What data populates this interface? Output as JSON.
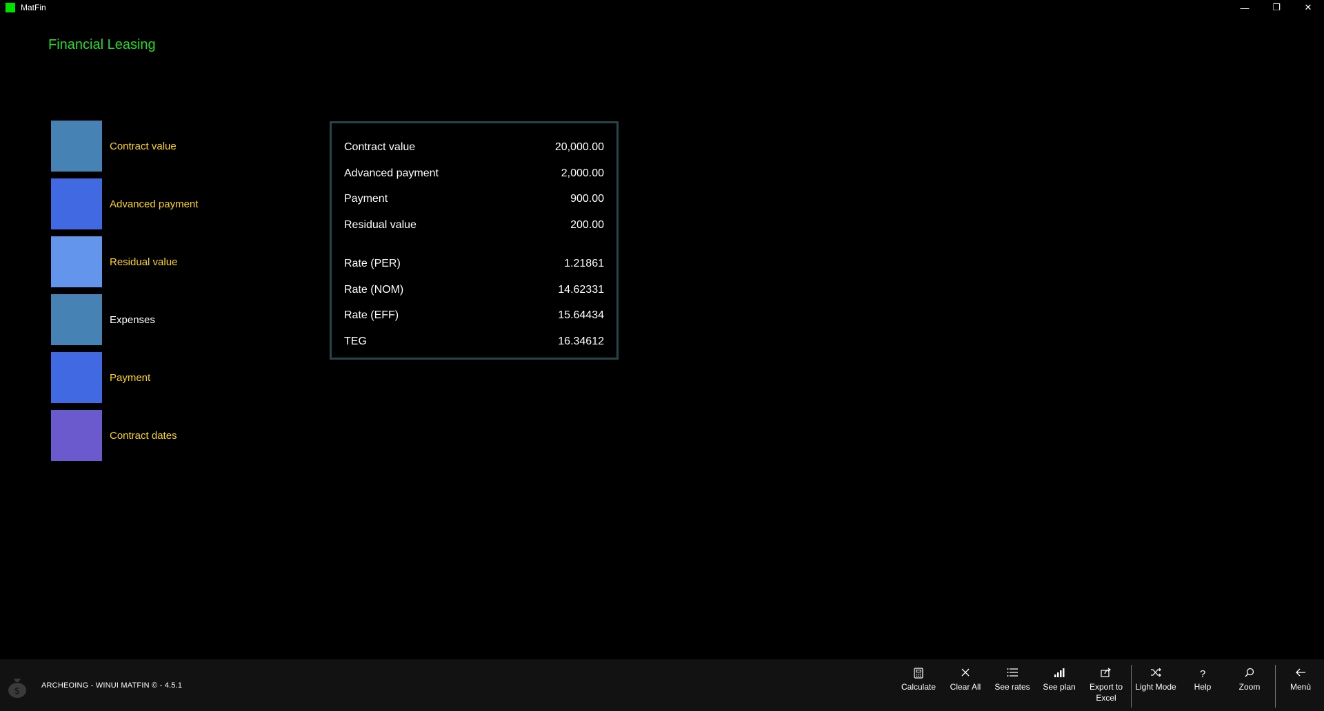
{
  "window": {
    "title": "MatFin",
    "controls": {
      "minimize": "—",
      "restore": "❐",
      "close": "✕"
    }
  },
  "page": {
    "title": "Financial Leasing"
  },
  "menu": {
    "items": [
      {
        "label": "Contract value",
        "tile_color": "#4682b4",
        "label_color": "#ffd700"
      },
      {
        "label": "Advanced payment",
        "tile_color": "#4169e1",
        "label_color": "#ffd700"
      },
      {
        "label": "Residual value",
        "tile_color": "#6495ed",
        "label_color": "#ffd700"
      },
      {
        "label": "Expenses",
        "tile_color": "#4682b4",
        "label_color": "#ffffff"
      },
      {
        "label": "Payment",
        "tile_color": "#4169e1",
        "label_color": "#ffd700"
      },
      {
        "label": "Contract dates",
        "tile_color": "#6a5acd",
        "label_color": "#ffd700"
      }
    ]
  },
  "results": {
    "rows": [
      {
        "label": "Contract value",
        "value": "20,000.00"
      },
      {
        "label": "Advanced payment",
        "value": "2,000.00"
      },
      {
        "label": "Payment",
        "value": "900.00"
      },
      {
        "label": "Residual value",
        "value": "200.00"
      },
      {
        "label": "Rate (PER)",
        "value": "1.21861"
      },
      {
        "label": "Rate (NOM)",
        "value": "14.62331"
      },
      {
        "label": "Rate (EFF)",
        "value": "15.64434"
      },
      {
        "label": "TEG",
        "value": "16.34612"
      }
    ]
  },
  "footer": {
    "text": "ARCHEOING - WINUI MATFIN © - 4.5.1"
  },
  "commands": {
    "calculate": {
      "label": "Calculate",
      "icon": "calculator-icon"
    },
    "clear_all": {
      "label": "Clear All",
      "icon": "close-icon"
    },
    "see_rates": {
      "label": "See rates",
      "icon": "list-icon"
    },
    "see_plan": {
      "label": "See plan",
      "icon": "bar-chart-icon"
    },
    "export": {
      "label": "Export to Excel",
      "icon": "share-icon"
    },
    "light_mode": {
      "label": "Light Mode",
      "icon": "shuffle-icon"
    },
    "help": {
      "label": "Help",
      "icon": "help-icon"
    },
    "zoom": {
      "label": "Zoom",
      "icon": "search-icon"
    },
    "menu": {
      "label": "Menù",
      "icon": "back-arrow-icon"
    }
  },
  "colors": {
    "accent_green": "#22dd22",
    "label_gold": "#ffd700",
    "panel_border": "#26444a",
    "bottom_bar": "#121212"
  }
}
